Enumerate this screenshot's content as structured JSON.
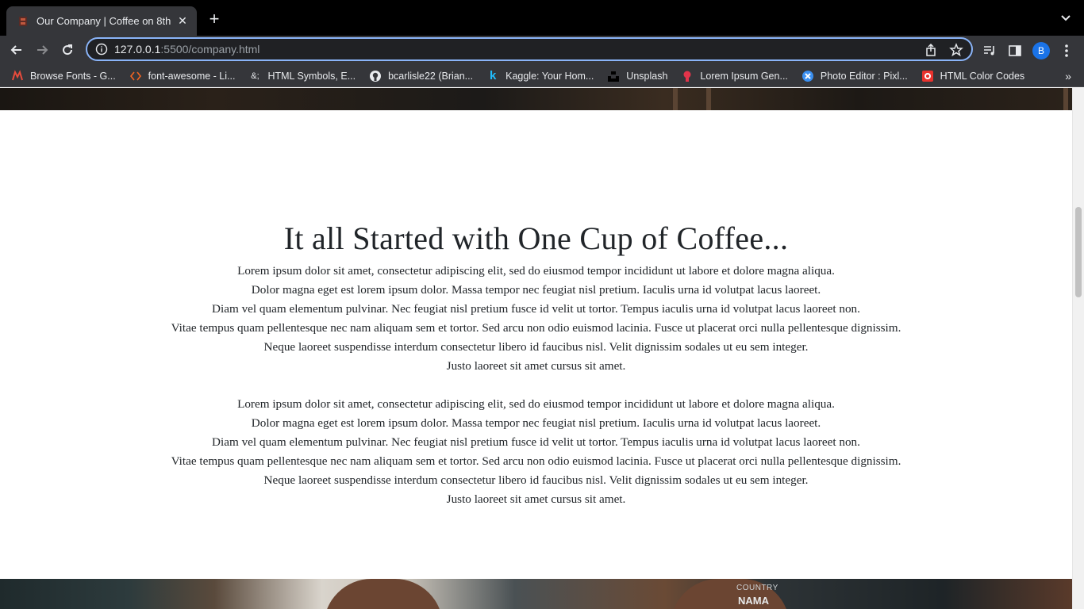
{
  "browser": {
    "tab_title": "Our Company | Coffee on 8th",
    "new_tab_label": "+",
    "close_label": "✕",
    "url_host": "127.0.0.1",
    "url_rest": ":5500/company.html",
    "profile_initial": "B",
    "bookmarks": [
      {
        "icon": "monotype-icon",
        "label": "Browse Fonts - G..."
      },
      {
        "icon": "code-icon",
        "label": "font-awesome - Li..."
      },
      {
        "icon": "ampersand-icon",
        "label": "HTML Symbols, E..."
      },
      {
        "icon": "github-icon",
        "label": "bcarlisle22 (Brian..."
      },
      {
        "icon": "kaggle-icon",
        "label": "Kaggle: Your Hom..."
      },
      {
        "icon": "unsplash-icon",
        "label": "Unsplash"
      },
      {
        "icon": "lorem-icon",
        "label": "Lorem Ipsum Gen..."
      },
      {
        "icon": "pixlr-icon",
        "label": "Photo Editor : Pixl..."
      },
      {
        "icon": "color-codes-icon",
        "label": "HTML Color Codes"
      }
    ],
    "more_bookmarks": "»"
  },
  "page": {
    "heading": "It all Started with One Cup of Coffee...",
    "paragraph1": [
      "Lorem ipsum dolor sit amet, consectetur adipiscing elit, sed do eiusmod tempor incididunt ut labore et dolore magna aliqua.",
      "Dolor magna eget est lorem ipsum dolor. Massa tempor nec feugiat nisl pretium. Iaculis urna id volutpat lacus laoreet.",
      "Diam vel quam elementum pulvinar. Nec feugiat nisl pretium fusce id velit ut tortor. Tempus iaculis urna id volutpat lacus laoreet non.",
      "Vitae tempus quam pellentesque nec nam aliquam sem et tortor. Sed arcu non odio euismod lacinia. Fusce ut placerat orci nulla pellentesque dignissim.",
      "Neque laoreet suspendisse interdum consectetur libero id faucibus nisl. Velit dignissim sodales ut eu sem integer.",
      "Justo laoreet sit amet cursus sit amet."
    ],
    "paragraph2": [
      "Lorem ipsum dolor sit amet, consectetur adipiscing elit, sed do eiusmod tempor incididunt ut labore et dolore magna aliqua.",
      "Dolor magna eget est lorem ipsum dolor. Massa tempor nec feugiat nisl pretium. Iaculis urna id volutpat lacus laoreet.",
      "Diam vel quam elementum pulvinar. Nec feugiat nisl pretium fusce id velit ut tortor. Tempus iaculis urna id volutpat lacus laoreet non.",
      "Vitae tempus quam pellentesque nec nam aliquam sem et tortor. Sed arcu non odio euismod lacinia. Fusce ut placerat orci nulla pellentesque dignissim.",
      "Neque laoreet suspendisse interdum consectetur libero id faucibus nisl. Velit dignissim sodales ut eu sem integer.",
      "Justo laoreet sit amet cursus sit amet."
    ],
    "photo_sign_top": "COUNTRY",
    "photo_sign_bottom": "NAMA"
  },
  "colors": {
    "accent": "#8ab4f8",
    "text": "#212529",
    "chrome_bg": "#35363a"
  }
}
